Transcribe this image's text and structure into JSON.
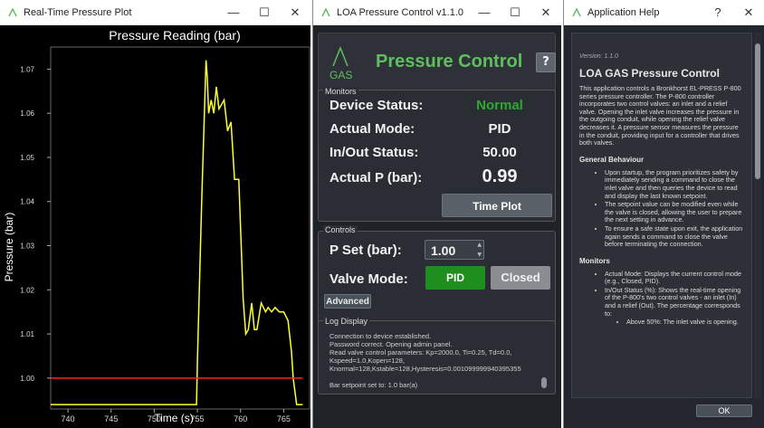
{
  "plot_window": {
    "title": "Real-Time Pressure Plot",
    "controls": [
      "—",
      "☐",
      "✕"
    ]
  },
  "chart_data": {
    "type": "line",
    "title": "Pressure Reading (bar)",
    "xlabel": "Time (s)",
    "ylabel": "Pressure (bar)",
    "xlim": [
      738,
      768
    ],
    "ylim": [
      0.993,
      1.075
    ],
    "x_ticks": [
      "740",
      "745",
      "750",
      "755",
      "760",
      "765"
    ],
    "y_ticks": [
      "1.00",
      "1.01",
      "1.02",
      "1.03",
      "1.04",
      "1.05",
      "1.06",
      "1.07"
    ],
    "grid": false,
    "background": "#000000",
    "series": [
      {
        "color": "#ffff33",
        "x": [
          738,
          754.9,
          755.0,
          755.5,
          756.0,
          756.15,
          756.3,
          756.6,
          756.9,
          757.2,
          757.5,
          757.8,
          758.1,
          758.5,
          758.9,
          759.3,
          759.8,
          760.3,
          760.6,
          760.9,
          761.3,
          761.6,
          761.9,
          762.4,
          762.9,
          763.2,
          763.6,
          764.0,
          764.5,
          765.0,
          765.5,
          765.9,
          766.1,
          766.5,
          767.2
        ],
        "y": [
          0.994,
          0.994,
          1.004,
          1.04,
          1.072,
          1.068,
          1.06,
          1.063,
          1.06,
          1.066,
          1.061,
          1.062,
          1.063,
          1.056,
          1.058,
          1.045,
          1.045,
          1.018,
          1.01,
          1.011,
          1.017,
          1.011,
          1.011,
          1.017,
          1.015,
          1.016,
          1.015,
          1.016,
          1.015,
          1.015,
          1.013,
          1.006,
          1.0,
          0.994,
          0.994
        ]
      },
      {
        "color": "#ff2020",
        "x": [
          738,
          767.2
        ],
        "y": [
          1.0,
          1.0
        ]
      }
    ]
  },
  "control_window": {
    "title": "LOA Pressure Control v1.1.0",
    "controls": [
      "—",
      "☐",
      "✕"
    ],
    "logo_text": "GAS",
    "app_title": "Pressure Control",
    "help_label": "?",
    "monitors": {
      "group_label": "Monitors",
      "device_status_label": "Device Status:",
      "device_status_value": "Normal",
      "actual_mode_label": "Actual Mode:",
      "actual_mode_value": "PID",
      "inout_label": "In/Out Status:",
      "inout_value": "50.00",
      "actualp_label": "Actual P (bar):",
      "actualp_value": "0.99",
      "time_plot_label": "Time Plot"
    },
    "controls_group": {
      "group_label": "Controls",
      "pset_label": "P Set (bar):",
      "pset_value": "1.00",
      "valve_mode_label": "Valve Mode:",
      "pid_label": "PID",
      "closed_label": "Closed",
      "advanced_label": "Advanced"
    },
    "log": {
      "group_label": "Log Display",
      "text": "Connection to device established.\nPassword correct. Opening admin panel.\nRead valve control parameters: Kp=2000.0, Ti=0.25, Td=0.0, Kspeed=1.0,Kopen=128,\nKnormal=128,Kstable=128,Hysteresis=0.001099999940395355\n\nBar setpoint set to: 1.0 bar(a)"
    },
    "colors": {
      "accent_green": "#5fbf5f",
      "status_normal": "#2eaa2e",
      "pid_button": "#1e8f1e",
      "closed_button": "#8a8d91"
    }
  },
  "help_window": {
    "title": "Application Help",
    "controls": [
      "?",
      "✕"
    ],
    "version": "Version: 1.1.0",
    "heading": "LOA GAS Pressure Control",
    "intro": "This application controls a Bronkhorst EL-PRESS P-800 series pressure controller. The P-800 controller incorporates two control valves: an inlet and a relief valve. Opening the inlet valve increases the pressure in the outgoing conduit, while opening the relief valve decreases it. A pressure sensor measures the pressure in the conduit, providing input for a controller that drives both valves.",
    "general_heading": "General Behaviour",
    "general_items": [
      "Upon startup, the program prioritizes safety by immediately sending a command to close the inlet valve and then queries the device to read and display the last known setpoint.",
      "The setpoint value can be modified even while the valve is closed, allowing the user to prepare the next setting in advance.",
      "To ensure a safe state upon exit, the application again sends a command to close the valve before terminating the connection."
    ],
    "monitors_heading": "Monitors",
    "monitors_items": [
      "Actual Mode: Displays the current control mode (e.g., Closed, PID).",
      "In/Out Status (%): Shows the real-time opening of the P-800's two control valves - an inlet (In) and a relief (Out). The percentage corresponds to:"
    ],
    "sub_item": "Above 50%: The inlet valve is opening.",
    "ok_label": "OK"
  }
}
